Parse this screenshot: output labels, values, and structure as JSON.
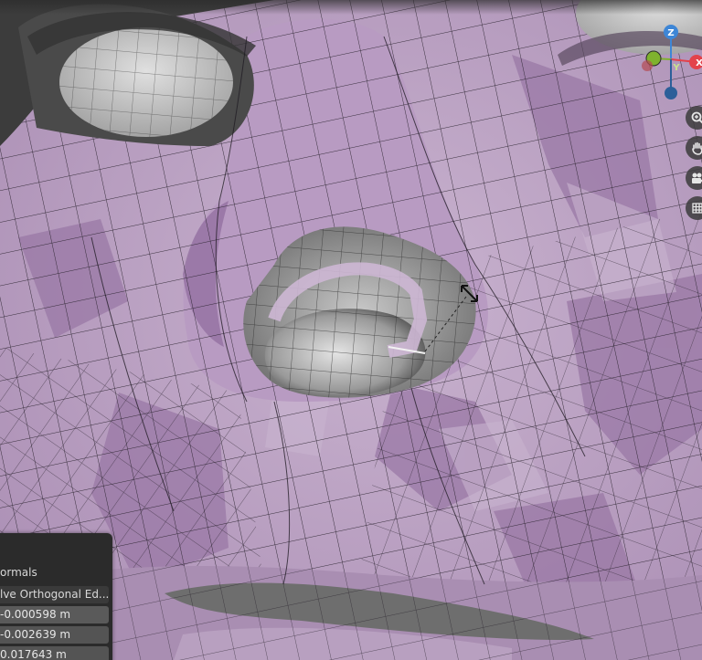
{
  "viewport": {
    "object": "face mesh",
    "mesh_color": "#b79ac0",
    "mesh_shadow_color": "#9c7aa6",
    "edge_color": "#1f1a22",
    "unselected_color": "#a8a8a8"
  },
  "gizmo": {
    "x_label": "X",
    "y_label": "Y",
    "z_label": "Z",
    "x_color": "#e3424b",
    "y_color": "#7fb22e",
    "z_color": "#3e86d6"
  },
  "nav_buttons": [
    {
      "name": "zoom-icon"
    },
    {
      "name": "hand-pan-icon"
    },
    {
      "name": "camera-icon"
    },
    {
      "name": "grid-ortho-icon"
    }
  ],
  "operator_panel": {
    "label_normals": "ormals",
    "dropdown_mode": "lve Orthogonal Ed...",
    "value_x": "-0.000598 m",
    "value_y": "-0.002639 m",
    "value_z": "0.017643 m"
  }
}
